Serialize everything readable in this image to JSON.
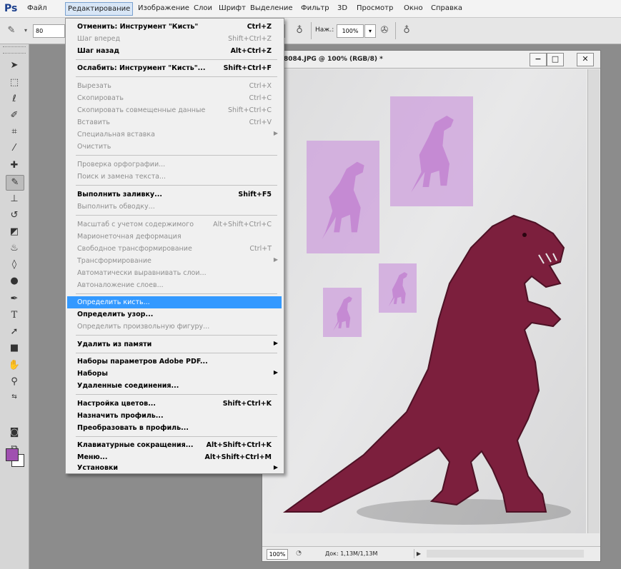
{
  "app": {
    "logo": "Ps"
  },
  "menubar": {
    "items": [
      "Файл",
      "Редактирование",
      "Изображение",
      "Слои",
      "Шрифт",
      "Выделение",
      "Фильтр",
      "3D",
      "Просмотр",
      "Окно",
      "Справка"
    ],
    "active_index": 1
  },
  "options": {
    "brush_size": "80",
    "opacity_label": "Наж.:",
    "opacity_value": "100%"
  },
  "colors": {
    "foreground": "#a050b0",
    "background": "#ffffff",
    "highlight": "#3399ff",
    "dino": "#7c1f3d"
  },
  "document": {
    "title": "8084.JPG @ 100% (RGB/8) *",
    "minimize": "−",
    "maximize": "□",
    "close": "✕",
    "zoom": "100%",
    "info": "Док: 1,13M/1,13M"
  },
  "edit_menu": {
    "items": [
      {
        "label": "Отменить: Инструмент \"Кисть\"",
        "shortcut": "Ctrl+Z"
      },
      {
        "label": "Шаг вперед",
        "shortcut": "Shift+Ctrl+Z"
      },
      {
        "label": "Шаг назад",
        "shortcut": "Alt+Ctrl+Z"
      },
      {
        "label": "Ослабить: Инструмент \"Кисть\"...",
        "shortcut": "Shift+Ctrl+F"
      },
      {
        "label": "Вырезать",
        "shortcut": "Ctrl+X"
      },
      {
        "label": "Скопировать",
        "shortcut": "Ctrl+C"
      },
      {
        "label": "Скопировать совмещенные данные",
        "shortcut": "Shift+Ctrl+C"
      },
      {
        "label": "Вставить",
        "shortcut": "Ctrl+V"
      },
      {
        "label": "Специальная вставка",
        "shortcut": ""
      },
      {
        "label": "Очистить",
        "shortcut": ""
      },
      {
        "label": "Проверка орфографии...",
        "shortcut": ""
      },
      {
        "label": "Поиск и замена текста...",
        "shortcut": ""
      },
      {
        "label": "Выполнить заливку...",
        "shortcut": "Shift+F5"
      },
      {
        "label": "Выполнить обводку...",
        "shortcut": ""
      },
      {
        "label": "Масштаб с учетом содержимого",
        "shortcut": "Alt+Shift+Ctrl+C"
      },
      {
        "label": "Марионеточная деформация",
        "shortcut": ""
      },
      {
        "label": "Свободное трансформирование",
        "shortcut": "Ctrl+T"
      },
      {
        "label": "Трансформирование",
        "shortcut": ""
      },
      {
        "label": "Автоматически выравнивать слои...",
        "shortcut": ""
      },
      {
        "label": "Автоналожение слоев...",
        "shortcut": ""
      },
      {
        "label": "Определить кисть...",
        "shortcut": ""
      },
      {
        "label": "Определить узор...",
        "shortcut": ""
      },
      {
        "label": "Определить произвольную фигуру...",
        "shortcut": ""
      },
      {
        "label": "Удалить из памяти",
        "shortcut": ""
      },
      {
        "label": "Наборы параметров Adobe PDF...",
        "shortcut": ""
      },
      {
        "label": "Наборы",
        "shortcut": ""
      },
      {
        "label": "Удаленные соединения...",
        "shortcut": ""
      },
      {
        "label": "Настройка цветов...",
        "shortcut": "Shift+Ctrl+K"
      },
      {
        "label": "Назначить профиль...",
        "shortcut": ""
      },
      {
        "label": "Преобразовать в профиль...",
        "shortcut": ""
      },
      {
        "label": "Клавиатурные сокращения...",
        "shortcut": "Alt+Shift+Ctrl+K"
      },
      {
        "label": "Меню...",
        "shortcut": "Alt+Shift+Ctrl+M"
      },
      {
        "label": "Установки",
        "shortcut": ""
      }
    ]
  }
}
